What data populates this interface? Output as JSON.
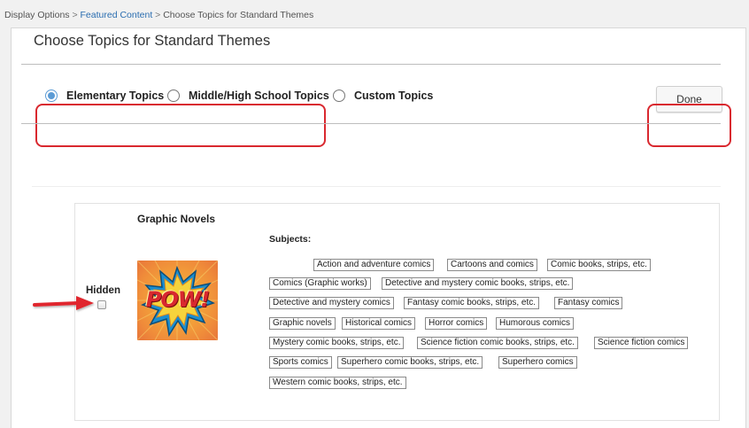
{
  "breadcrumb": {
    "items": [
      "Display Options",
      "Featured Content",
      "Choose Topics for Standard Themes"
    ],
    "separator": ">"
  },
  "page": {
    "title": "Choose Topics for Standard Themes"
  },
  "topic_sets": {
    "options": [
      {
        "label": "Elementary Topics",
        "selected": true
      },
      {
        "label": "Middle/High School Topics",
        "selected": false
      },
      {
        "label": "Custom Topics",
        "selected": false
      }
    ]
  },
  "actions": {
    "done_label": "Done"
  },
  "topic": {
    "title": "Graphic Novels",
    "image_text": "POW!",
    "hidden_label": "Hidden",
    "hidden_checked": false,
    "subjects_label": "Subjects:",
    "subjects": [
      "Action and adventure comics",
      "Cartoons and comics",
      "Comic books, strips, etc.",
      "Comics (Graphic works)",
      "Detective and mystery comic books, strips, etc.",
      "Detective and mystery comics",
      "Fantasy comic books, strips, etc.",
      "Fantasy comics",
      "Graphic novels",
      "Historical comics",
      "Horror comics",
      "Humorous comics",
      "Mystery comic books, strips, etc.",
      "Science fiction comic books, strips, etc.",
      "Science fiction comics",
      "Sports comics",
      "Superhero comic books, strips, etc.",
      "Superhero comics",
      "Western comic books, strips, etc."
    ]
  },
  "colors": {
    "highlight": "#d9282f",
    "radio_selected": "#5b9bd5",
    "link": "#2a6db0"
  }
}
